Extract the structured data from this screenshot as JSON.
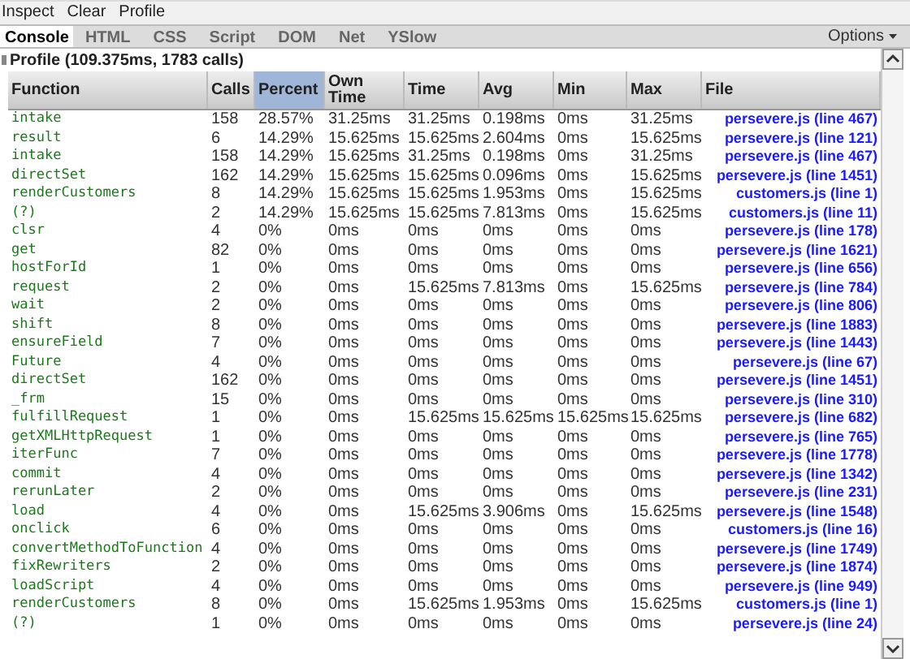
{
  "menu": [
    "Inspect",
    "Clear",
    "Profile"
  ],
  "tabs": [
    {
      "label": "Console",
      "selected": true
    },
    {
      "label": "HTML",
      "selected": false
    },
    {
      "label": "CSS",
      "selected": false
    },
    {
      "label": "Script",
      "selected": false
    },
    {
      "label": "DOM",
      "selected": false
    },
    {
      "label": "Net",
      "selected": false
    },
    {
      "label": "YSlow",
      "selected": false
    }
  ],
  "options": "Options",
  "profile_title": "Profile (109.375ms, 1783 calls)",
  "table": {
    "columns": [
      {
        "label": "Function",
        "selected": false
      },
      {
        "label": "Calls",
        "selected": false
      },
      {
        "label": "Percent",
        "selected": true
      },
      {
        "label": "Own Time",
        "selected": false
      },
      {
        "label": "Time",
        "selected": false
      },
      {
        "label": "Avg",
        "selected": false
      },
      {
        "label": "Min",
        "selected": false
      },
      {
        "label": "Max",
        "selected": false
      },
      {
        "label": "File",
        "selected": false
      }
    ],
    "rows": [
      [
        "intake",
        "158",
        "28.57%",
        "31.25ms",
        "31.25ms",
        "0.198ms",
        "0ms",
        "31.25ms",
        "persevere.js (line 467)"
      ],
      [
        "result",
        "6",
        "14.29%",
        "15.625ms",
        "15.625ms",
        "2.604ms",
        "0ms",
        "15.625ms",
        "persevere.js (line 121)"
      ],
      [
        "intake",
        "158",
        "14.29%",
        "15.625ms",
        "31.25ms",
        "0.198ms",
        "0ms",
        "31.25ms",
        "persevere.js (line 467)"
      ],
      [
        "directSet",
        "162",
        "14.29%",
        "15.625ms",
        "15.625ms",
        "0.096ms",
        "0ms",
        "15.625ms",
        "persevere.js (line 1451)"
      ],
      [
        "renderCustomers",
        "8",
        "14.29%",
        "15.625ms",
        "15.625ms",
        "1.953ms",
        "0ms",
        "15.625ms",
        "customers.js (line 1)"
      ],
      [
        "(?)",
        "2",
        "14.29%",
        "15.625ms",
        "15.625ms",
        "7.813ms",
        "0ms",
        "15.625ms",
        "customers.js (line 11)"
      ],
      [
        "clsr",
        "4",
        "0%",
        "0ms",
        "0ms",
        "0ms",
        "0ms",
        "0ms",
        "persevere.js (line 178)"
      ],
      [
        "get",
        "82",
        "0%",
        "0ms",
        "0ms",
        "0ms",
        "0ms",
        "0ms",
        "persevere.js (line 1621)"
      ],
      [
        "hostForId",
        "1",
        "0%",
        "0ms",
        "0ms",
        "0ms",
        "0ms",
        "0ms",
        "persevere.js (line 656)"
      ],
      [
        "request",
        "2",
        "0%",
        "0ms",
        "15.625ms",
        "7.813ms",
        "0ms",
        "15.625ms",
        "persevere.js (line 784)"
      ],
      [
        "wait",
        "2",
        "0%",
        "0ms",
        "0ms",
        "0ms",
        "0ms",
        "0ms",
        "persevere.js (line 806)"
      ],
      [
        "shift",
        "8",
        "0%",
        "0ms",
        "0ms",
        "0ms",
        "0ms",
        "0ms",
        "persevere.js (line 1883)"
      ],
      [
        "ensureField",
        "7",
        "0%",
        "0ms",
        "0ms",
        "0ms",
        "0ms",
        "0ms",
        "persevere.js (line 1443)"
      ],
      [
        "Future",
        "4",
        "0%",
        "0ms",
        "0ms",
        "0ms",
        "0ms",
        "0ms",
        "persevere.js (line 67)"
      ],
      [
        "directSet",
        "162",
        "0%",
        "0ms",
        "0ms",
        "0ms",
        "0ms",
        "0ms",
        "persevere.js (line 1451)"
      ],
      [
        "_frm",
        "15",
        "0%",
        "0ms",
        "0ms",
        "0ms",
        "0ms",
        "0ms",
        "persevere.js (line 310)"
      ],
      [
        "fulfillRequest",
        "1",
        "0%",
        "0ms",
        "15.625ms",
        "15.625ms",
        "15.625ms",
        "15.625ms",
        "persevere.js (line 682)"
      ],
      [
        "getXMLHttpRequest",
        "1",
        "0%",
        "0ms",
        "0ms",
        "0ms",
        "0ms",
        "0ms",
        "persevere.js (line 765)"
      ],
      [
        "iterFunc",
        "7",
        "0%",
        "0ms",
        "0ms",
        "0ms",
        "0ms",
        "0ms",
        "persevere.js (line 1778)"
      ],
      [
        "commit",
        "4",
        "0%",
        "0ms",
        "0ms",
        "0ms",
        "0ms",
        "0ms",
        "persevere.js (line 1342)"
      ],
      [
        "rerunLater",
        "2",
        "0%",
        "0ms",
        "0ms",
        "0ms",
        "0ms",
        "0ms",
        "persevere.js (line 231)"
      ],
      [
        "load",
        "4",
        "0%",
        "0ms",
        "15.625ms",
        "3.906ms",
        "0ms",
        "15.625ms",
        "persevere.js (line 1548)"
      ],
      [
        "onclick",
        "6",
        "0%",
        "0ms",
        "0ms",
        "0ms",
        "0ms",
        "0ms",
        "customers.js (line 16)"
      ],
      [
        "convertMethodToFunction",
        "4",
        "0%",
        "0ms",
        "0ms",
        "0ms",
        "0ms",
        "0ms",
        "persevere.js (line 1749)"
      ],
      [
        "fixRewriters",
        "2",
        "0%",
        "0ms",
        "0ms",
        "0ms",
        "0ms",
        "0ms",
        "persevere.js (line 1874)"
      ],
      [
        "loadScript",
        "4",
        "0%",
        "0ms",
        "0ms",
        "0ms",
        "0ms",
        "0ms",
        "persevere.js (line 949)"
      ],
      [
        "renderCustomers",
        "8",
        "0%",
        "0ms",
        "15.625ms",
        "1.953ms",
        "0ms",
        "15.625ms",
        "customers.js (line 1)"
      ],
      [
        "(?)",
        "1",
        "0%",
        "0ms",
        "0ms",
        "0ms",
        "0ms",
        "0ms",
        "persevere.js (line 24)"
      ]
    ]
  }
}
